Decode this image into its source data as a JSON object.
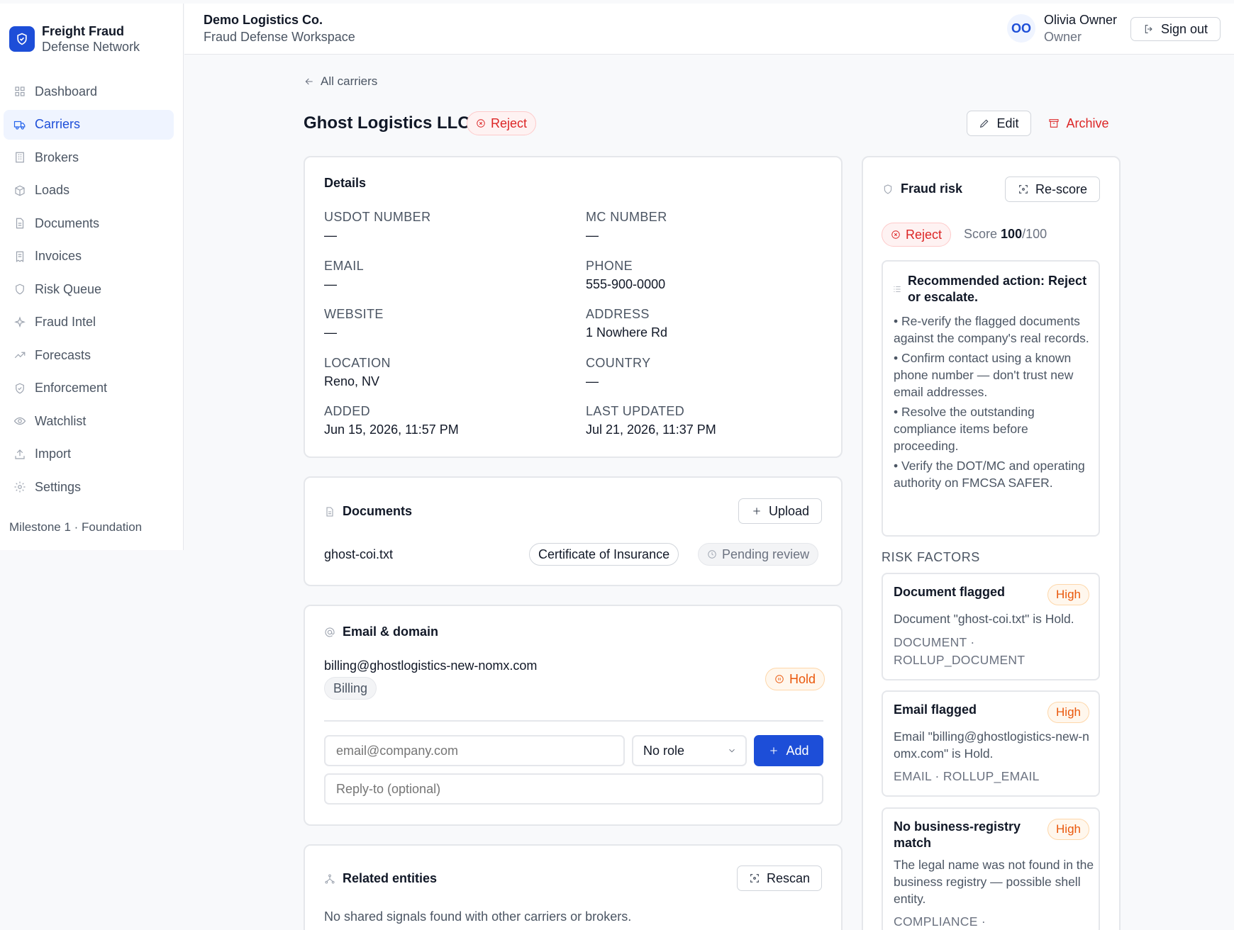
{
  "brand": {
    "line1": "Freight Fraud",
    "line2": "Defense Network"
  },
  "sidebar": {
    "items": [
      {
        "label": "Dashboard",
        "icon": "grid-icon"
      },
      {
        "label": "Carriers",
        "icon": "truck-icon",
        "active": true
      },
      {
        "label": "Brokers",
        "icon": "building-icon"
      },
      {
        "label": "Loads",
        "icon": "package-icon"
      },
      {
        "label": "Documents",
        "icon": "file-icon"
      },
      {
        "label": "Invoices",
        "icon": "receipt-icon"
      },
      {
        "label": "Risk Queue",
        "icon": "shield-icon"
      },
      {
        "label": "Fraud Intel",
        "icon": "sparkle-icon"
      },
      {
        "label": "Forecasts",
        "icon": "trend-icon"
      },
      {
        "label": "Enforcement",
        "icon": "shield-check-icon"
      },
      {
        "label": "Watchlist",
        "icon": "eye-icon"
      },
      {
        "label": "Import",
        "icon": "upload-icon"
      },
      {
        "label": "Settings",
        "icon": "gear-icon"
      }
    ],
    "milestone": "Milestone 1 · Foundation"
  },
  "topbar": {
    "org_name": "Demo Logistics Co.",
    "workspace": "Fraud Defense Workspace",
    "avatar_initials": "OO",
    "user_name": "Olivia Owner",
    "user_role": "Owner",
    "sign_out": "Sign out"
  },
  "page": {
    "back_label": "All carriers",
    "title": "Ghost Logistics LLC",
    "status": "Reject",
    "edit_label": "Edit",
    "archive_label": "Archive"
  },
  "details": {
    "heading": "Details",
    "fields": {
      "usdot": {
        "label": "USDOT NUMBER",
        "value": "—"
      },
      "mc": {
        "label": "MC NUMBER",
        "value": "—"
      },
      "email": {
        "label": "EMAIL",
        "value": "—"
      },
      "phone": {
        "label": "PHONE",
        "value": "555-900-0000"
      },
      "website": {
        "label": "WEBSITE",
        "value": "—"
      },
      "address": {
        "label": "ADDRESS",
        "value": "1 Nowhere Rd"
      },
      "location": {
        "label": "LOCATION",
        "value": "Reno, NV"
      },
      "country": {
        "label": "COUNTRY",
        "value": "—"
      },
      "added": {
        "label": "ADDED",
        "value": "Jun 15, 2026, 11:57 PM"
      },
      "updated": {
        "label": "LAST UPDATED",
        "value": "Jul 21, 2026, 11:37 PM"
      }
    }
  },
  "documents": {
    "heading": "Documents",
    "upload_label": "Upload",
    "rows": [
      {
        "filename": "ghost-coi.txt",
        "type": "Certificate of Insurance",
        "status": "Pending review"
      }
    ]
  },
  "email_domain": {
    "heading": "Email & domain",
    "address": "billing@ghostlogistics-new-nomx.com",
    "role": "Billing",
    "status": "Hold",
    "email_placeholder": "email@company.com",
    "role_select": "No role",
    "add_label": "Add",
    "reply_placeholder": "Reply-to (optional)"
  },
  "related": {
    "heading": "Related entities",
    "rescan_label": "Rescan",
    "empty_text": "No shared signals found with other carriers or brokers."
  },
  "fraud_risk": {
    "heading": "Fraud risk",
    "rescore_label": "Re-score",
    "verdict": "Reject",
    "score_prefix": "Score",
    "score": "100",
    "score_max": "/100",
    "recommendation_title": "Recommended action: Reject or escalate.",
    "recommendations": [
      "• Re-verify the flagged documents against the company's real records.",
      "• Confirm contact using a known phone number — don't trust new email addresses.",
      "• Resolve the outstanding compliance items before proceeding.",
      "• Verify the DOT/MC and operating authority on FMCSA SAFER."
    ],
    "factors_heading": "RISK FACTORS",
    "factors": [
      {
        "title": "Document flagged",
        "severity": "High",
        "description": "Document \"ghost-coi.txt\" is Hold.",
        "code": "DOCUMENT · ROLLUP_DOCUMENT"
      },
      {
        "title": "Email flagged",
        "severity": "High",
        "description": "Email \"billing@ghostlogistics-new-nomx.com\" is Hold.",
        "code": "EMAIL · ROLLUP_EMAIL"
      },
      {
        "title": "No business-registry match",
        "severity": "High",
        "description": "The legal name was not found in the business registry — possible shell entity.",
        "code": "COMPLIANCE ·"
      }
    ]
  }
}
